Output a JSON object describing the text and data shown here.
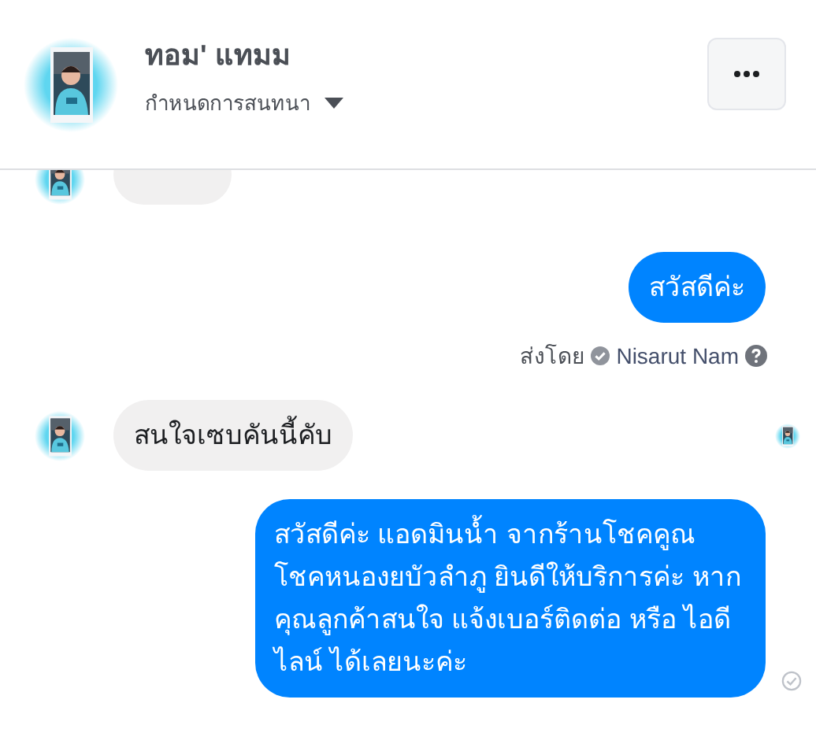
{
  "header": {
    "name": "ทอม' แทมม",
    "subtitle": "กำหนดการสนทนา"
  },
  "messages": [
    {
      "kind": "incoming-cut"
    },
    {
      "kind": "outgoing",
      "text": "สวัสดีค่ะ"
    },
    {
      "kind": "sent-by",
      "prefix": "ส่งโดย",
      "sender": "Nisarut Nam"
    },
    {
      "kind": "incoming",
      "text": "สนใจเซบคันนี้คับ",
      "seen": true
    },
    {
      "kind": "outgoing",
      "text": "สวัสดีค่ะ แอดมินน้ำ จากร้านโชคคูณ โชคหนองยบัวลำภู ยินดีให้บริการค่ะ หากคุณลูกค้าสนใจ แจ้งเบอร์ติดต่อ หรือ ไอดีไลน์ ได้เลยนะค่ะ",
      "sent": true
    }
  ]
}
